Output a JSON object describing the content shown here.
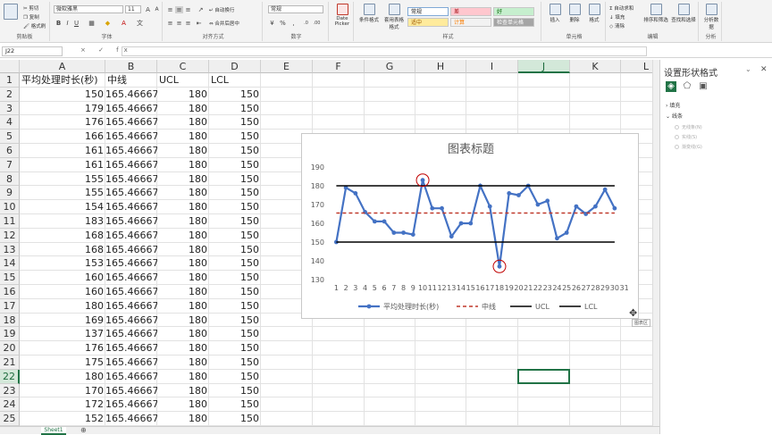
{
  "ribbon": {
    "clipboard": {
      "cut": "剪切",
      "copy": "复制",
      "format_painter": "格式刷",
      "label": "剪贴板"
    },
    "font": {
      "name": "微软雅黑",
      "size": "11",
      "label": "字体"
    },
    "alignment": {
      "wrap": "自动换行",
      "merge": "合并后居中",
      "label": "对齐方式"
    },
    "number": {
      "format": "常规",
      "label": "数字"
    },
    "date_picker": {
      "label": "Date Picker"
    },
    "styles": {
      "cond_format": "条件格式",
      "table_format": "套用表格格式",
      "normal": "常规",
      "bad": "差",
      "good": "好",
      "neutral": "适中",
      "calc": "计算",
      "check_cell": "检查单元格",
      "label": "样式"
    },
    "cells": {
      "insert": "插入",
      "delete": "删除",
      "format": "格式",
      "label": "单元格"
    },
    "editing": {
      "autosum": "自动求和",
      "fill": "填充",
      "clear": "清除",
      "sort_filter": "排序和筛选",
      "find_select": "查找和选择",
      "label": "编辑"
    },
    "analysis": {
      "analyze": "分析数据",
      "label": "分析"
    }
  },
  "formula_bar": {
    "name_box": "J22",
    "fx": "× ✓ fx"
  },
  "columns": [
    "A",
    "B",
    "C",
    "D",
    "E",
    "F",
    "G",
    "H",
    "I",
    "J",
    "K",
    "L"
  ],
  "selected_column": "J",
  "selected_row": 22,
  "row_numbers": [
    1,
    2,
    3,
    4,
    5,
    6,
    7,
    8,
    9,
    10,
    11,
    12,
    13,
    14,
    15,
    16,
    17,
    18,
    19,
    20,
    21,
    22,
    23,
    24,
    25
  ],
  "headers": [
    "平均处理时长(秒)",
    "中线",
    "UCL",
    "LCL"
  ],
  "rows": [
    [
      "150",
      "165.46667",
      "180",
      "150"
    ],
    [
      "179",
      "165.46667",
      "180",
      "150"
    ],
    [
      "176",
      "165.46667",
      "180",
      "150"
    ],
    [
      "166",
      "165.46667",
      "180",
      "150"
    ],
    [
      "161",
      "165.46667",
      "180",
      "150"
    ],
    [
      "161",
      "165.46667",
      "180",
      "150"
    ],
    [
      "155",
      "165.46667",
      "180",
      "150"
    ],
    [
      "155",
      "165.46667",
      "180",
      "150"
    ],
    [
      "154",
      "165.46667",
      "180",
      "150"
    ],
    [
      "183",
      "165.46667",
      "180",
      "150"
    ],
    [
      "168",
      "165.46667",
      "180",
      "150"
    ],
    [
      "168",
      "165.46667",
      "180",
      "150"
    ],
    [
      "153",
      "165.46667",
      "180",
      "150"
    ],
    [
      "160",
      "165.46667",
      "180",
      "150"
    ],
    [
      "160",
      "165.46667",
      "180",
      "150"
    ],
    [
      "180",
      "165.46667",
      "180",
      "150"
    ],
    [
      "169",
      "165.46667",
      "180",
      "150"
    ],
    [
      "137",
      "165.46667",
      "180",
      "150"
    ],
    [
      "176",
      "165.46667",
      "180",
      "150"
    ],
    [
      "175",
      "165.46667",
      "180",
      "150"
    ],
    [
      "180",
      "165.46667",
      "180",
      "150"
    ],
    [
      "170",
      "165.46667",
      "180",
      "150"
    ],
    [
      "172",
      "165.46667",
      "180",
      "150"
    ],
    [
      "152",
      "165.46667",
      "180",
      "150"
    ]
  ],
  "chart_data": {
    "type": "line",
    "title": "图表标题",
    "x": [
      1,
      2,
      3,
      4,
      5,
      6,
      7,
      8,
      9,
      10,
      11,
      12,
      13,
      14,
      15,
      16,
      17,
      18,
      19,
      20,
      21,
      22,
      23,
      24,
      25,
      26,
      27,
      28,
      29,
      30,
      31
    ],
    "ylim": [
      130,
      190
    ],
    "yticks": [
      130,
      140,
      150,
      160,
      170,
      180,
      190
    ],
    "grid": false,
    "legend": "bottom",
    "series": [
      {
        "name": "平均处理时长(秒)",
        "color": "#4472c4",
        "style": "line-markers",
        "values": [
          150,
          179,
          176,
          166,
          161,
          161,
          155,
          155,
          154,
          183,
          168,
          168,
          153,
          160,
          160,
          180,
          169,
          137,
          176,
          175,
          180,
          170,
          172,
          152,
          155,
          169,
          165,
          169,
          178,
          168
        ]
      },
      {
        "name": "中线",
        "color": "#c0392b",
        "style": "dashed",
        "values": [
          165.46667,
          165.46667,
          165.46667,
          165.46667,
          165.46667,
          165.46667,
          165.46667,
          165.46667,
          165.46667,
          165.46667,
          165.46667,
          165.46667,
          165.46667,
          165.46667,
          165.46667,
          165.46667,
          165.46667,
          165.46667,
          165.46667,
          165.46667,
          165.46667,
          165.46667,
          165.46667,
          165.46667,
          165.46667,
          165.46667,
          165.46667,
          165.46667,
          165.46667,
          165.46667
        ]
      },
      {
        "name": "UCL",
        "color": "#000000",
        "style": "solid",
        "values": [
          180,
          180,
          180,
          180,
          180,
          180,
          180,
          180,
          180,
          180,
          180,
          180,
          180,
          180,
          180,
          180,
          180,
          180,
          180,
          180,
          180,
          180,
          180,
          180,
          180,
          180,
          180,
          180,
          180,
          180
        ]
      },
      {
        "name": "LCL",
        "color": "#000000",
        "style": "solid",
        "values": [
          150,
          150,
          150,
          150,
          150,
          150,
          150,
          150,
          150,
          150,
          150,
          150,
          150,
          150,
          150,
          150,
          150,
          150,
          150,
          150,
          150,
          150,
          150,
          150,
          150,
          150,
          150,
          150,
          150,
          150
        ]
      }
    ],
    "highlighted_points": [
      10,
      18
    ]
  },
  "chart_tooltip": "图表区",
  "sheet_tab": "Sheet1",
  "pane": {
    "title": "设置形状格式",
    "fill": "填充",
    "line": "线条",
    "options": [
      "无线条(N)",
      "实线(S)",
      "渐变线(G)"
    ]
  }
}
